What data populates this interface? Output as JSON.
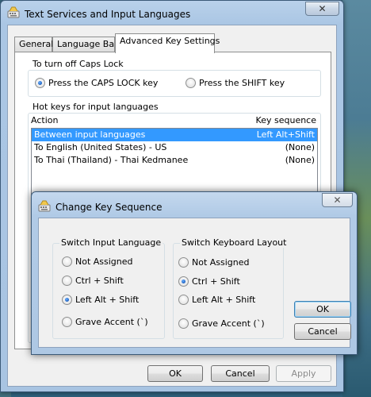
{
  "window": {
    "title": "Text Services and Input Languages",
    "close_glyph": "✕"
  },
  "tabs": [
    "General",
    "Language Bar",
    "Advanced Key Settings"
  ],
  "active_tab": "Advanced Key Settings",
  "caps_lock": {
    "title": "To turn off Caps Lock",
    "options": [
      {
        "label": "Press the CAPS LOCK key",
        "selected": true
      },
      {
        "label": "Press the SHIFT key",
        "selected": false
      }
    ]
  },
  "hotkeys": {
    "title": "Hot keys for input languages",
    "columns": {
      "action": "Action",
      "sequence": "Key sequence"
    },
    "rows": [
      {
        "action": "Between input languages",
        "sequence": "Left Alt+Shift",
        "selected": true
      },
      {
        "action": "To English (United States) - US",
        "sequence": "(None)",
        "selected": false
      },
      {
        "action": "To Thai (Thailand) - Thai Kedmanee",
        "sequence": "(None)",
        "selected": false
      }
    ]
  },
  "main_buttons": {
    "ok": "OK",
    "cancel": "Cancel",
    "apply": "Apply"
  },
  "dialog": {
    "title": "Change Key Sequence",
    "close_glyph": "✕",
    "switch_input_language": {
      "title": "Switch Input Language",
      "options": [
        {
          "label": "Not Assigned",
          "selected": false
        },
        {
          "label": "Ctrl + Shift",
          "selected": false
        },
        {
          "label": "Left Alt + Shift",
          "selected": true
        },
        {
          "label": "Grave Accent (`)",
          "selected": false
        }
      ]
    },
    "switch_keyboard_layout": {
      "title": "Switch Keyboard Layout",
      "options": [
        {
          "label": "Not Assigned",
          "selected": false
        },
        {
          "label": "Ctrl + Shift",
          "selected": true
        },
        {
          "label": "Left Alt + Shift",
          "selected": false
        },
        {
          "label": "Grave Accent (`)",
          "selected": false
        }
      ]
    },
    "buttons": {
      "ok": "OK",
      "cancel": "Cancel"
    }
  },
  "colors": {
    "selection": "#3399ff",
    "radio_dot": "#1a5fbf"
  }
}
